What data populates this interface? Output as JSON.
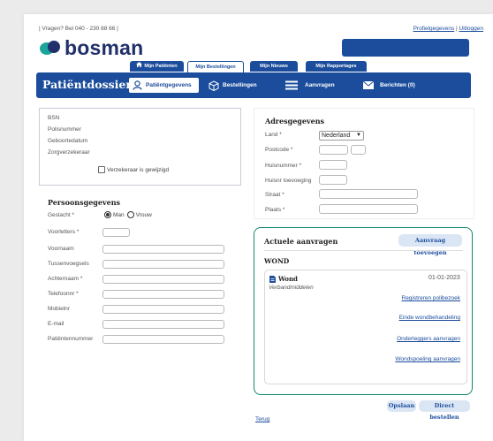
{
  "topbar": {
    "phone": "| Vragen? Bel 040 - 230 88 66 |",
    "profile_link": "Profielgegevens",
    "separator": "|",
    "logout_link": "Uitloggen"
  },
  "logo": {
    "text": "bosman"
  },
  "tabs": [
    {
      "label": "Mijn Patiënten",
      "icon": "home-icon",
      "active": false
    },
    {
      "label": "Mijn Bestellingen",
      "active": true
    },
    {
      "label": "Mijn Nieuws",
      "active": false
    },
    {
      "label": "Mijn Rapportages",
      "active": false
    }
  ],
  "navbar": {
    "title": "Patiëntdossier",
    "items": [
      {
        "label": "Patiëntgegevens",
        "icon": "user-icon",
        "active": true
      },
      {
        "label": "Bestellingen",
        "icon": "box-icon",
        "active": false
      },
      {
        "label": "Aanvragen",
        "icon": "menu-icon",
        "active": false
      },
      {
        "label": "Berichten (0)",
        "icon": "envelope-icon",
        "active": false
      }
    ]
  },
  "insurance": {
    "fields": [
      "BSN",
      "Polisnummer",
      "Geboortedatum",
      "Zorgverzekeraar"
    ],
    "checkbox_label": "Verzekeraar is gewijzigd"
  },
  "personal": {
    "title": "Persoonsgegevens",
    "gender_label": "Geslacht *",
    "gender_male": "Man",
    "gender_female": "Vrouw",
    "fields": [
      "Voorletters *",
      "Voornaam",
      "Tussenvoegsels",
      "Achternaam *",
      "Telefoonnr *",
      "Mobielnr",
      "E-mail",
      "Patiëntennummer"
    ]
  },
  "address": {
    "title": "Adresgegevens",
    "land_label": "Land *",
    "land_value": "Nederland",
    "fields": [
      "Postcode *",
      "Huisnummer *",
      "Huisnr toevoeging",
      "Straat *",
      "Plaats *"
    ]
  },
  "requests": {
    "title": "Actuele aanvragen",
    "add_button": "Aanvraag toevoegen",
    "category": "WOND",
    "item_title": "Wond",
    "item_sub": "Verbandmiddelen",
    "item_date": "01-01-2023",
    "actions": [
      "Registreren polibezoek",
      "Einde wondbehandeling",
      "Onderleggers aanvragen",
      "Wondspoeling aanvragen"
    ]
  },
  "footer": {
    "save": "Opslaan",
    "order": "Direct bestellen",
    "back": "Terug"
  },
  "colors": {
    "brand_blue": "#1b4d9c",
    "accent_green": "#0f8a6e",
    "logo_teal": "#1aa69a"
  }
}
